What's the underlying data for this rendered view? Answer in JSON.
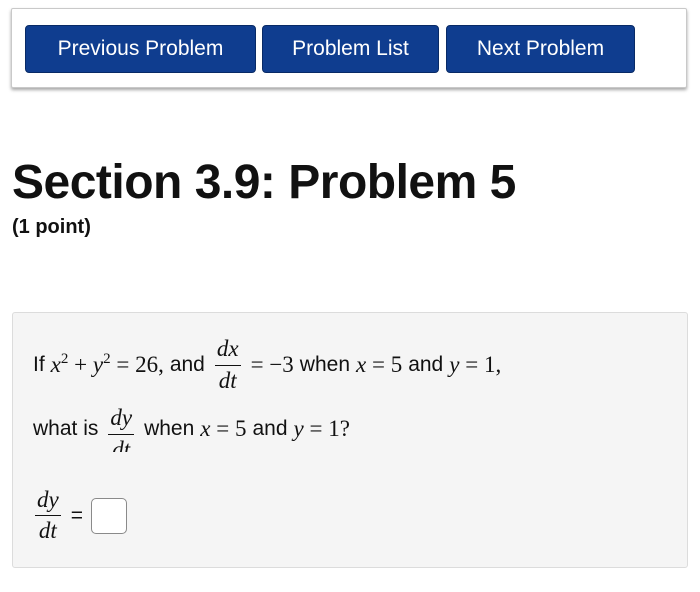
{
  "nav": {
    "previous": "Previous Problem",
    "list": "Problem List",
    "next": "Next Problem"
  },
  "header": {
    "title": "Section 3.9: Problem 5",
    "points": "(1 point)"
  },
  "problem": {
    "if": "If",
    "eq1_rhs": "= 26,",
    "and": "and",
    "dx": "dx",
    "dt": "dt",
    "eq2_rhs": "= −3",
    "when": "when",
    "x_eq": "= 5",
    "y_eq": "= 1,",
    "what_is": "what is",
    "dy": "dy",
    "when2": "when",
    "x_eq2": "= 5",
    "and2": "and",
    "y_eq2": "= 1?",
    "answer_dy": "dy",
    "answer_dt": "dt",
    "equals": "=",
    "answer_value": ""
  }
}
